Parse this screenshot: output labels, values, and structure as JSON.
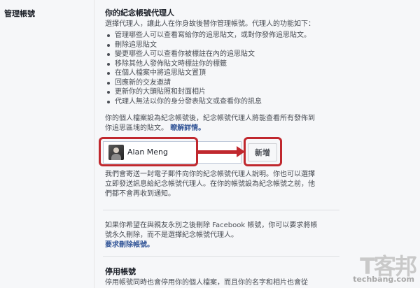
{
  "left": {
    "title": "管理帳號"
  },
  "legacy": {
    "title": "你的紀念帳號代理人",
    "intro": "選擇代理人，讓此人在你身故後替你管理帳號。代理人的功能如下：",
    "bullets": [
      "管理哪些人可以查看寫給你的追思貼文，或對你發佈追思貼文。",
      "刪除追思貼文",
      "變更哪些人可以查看你被標註在內的追思貼文",
      "移除其他人發佈貼文時標註你的標籤",
      "在個人檔案中將追思貼文置頂",
      "回應新的交友邀請",
      "更新你的大頭貼照和封面相片",
      "代理人無法以你的身分發表貼文或查看你的訊息"
    ],
    "memorial_line1": "你的個人檔案設為紀念帳號後，紀念帳號代理人將能查看所有發佈到",
    "memorial_line2": "你追思區塊的貼文。",
    "learn_more": "瞭解詳情。",
    "contact_name": "Alan Meng",
    "add_button": "新增",
    "email_line1": "我們會寄送一封電子郵件向你的紀念帳號代理人說明。你也可以選擇",
    "email_line2": "立即發送訊息給紀念帳號代理人。在你的帳號設為紀念帳號之前，他",
    "email_line3": "們都不會再收到通知。"
  },
  "delete": {
    "line1": "如果你希望在與親友永別之後刪除 Facebook 帳號，你可以要求將帳",
    "line2": "號永久刪除，而不是選擇紀念帳號代理人。",
    "link": "要求刪除帳號。"
  },
  "deactivate": {
    "title": "停用帳號",
    "line1": "停用帳號同時也會停用你的個人檔案，而且你的名字和相片也會從"
  },
  "watermark": {
    "mark": "T客邦",
    "text": "techbang.com"
  },
  "colors": {
    "highlight": "#c0282e",
    "link": "#365899",
    "background": "#f6f7f9"
  }
}
